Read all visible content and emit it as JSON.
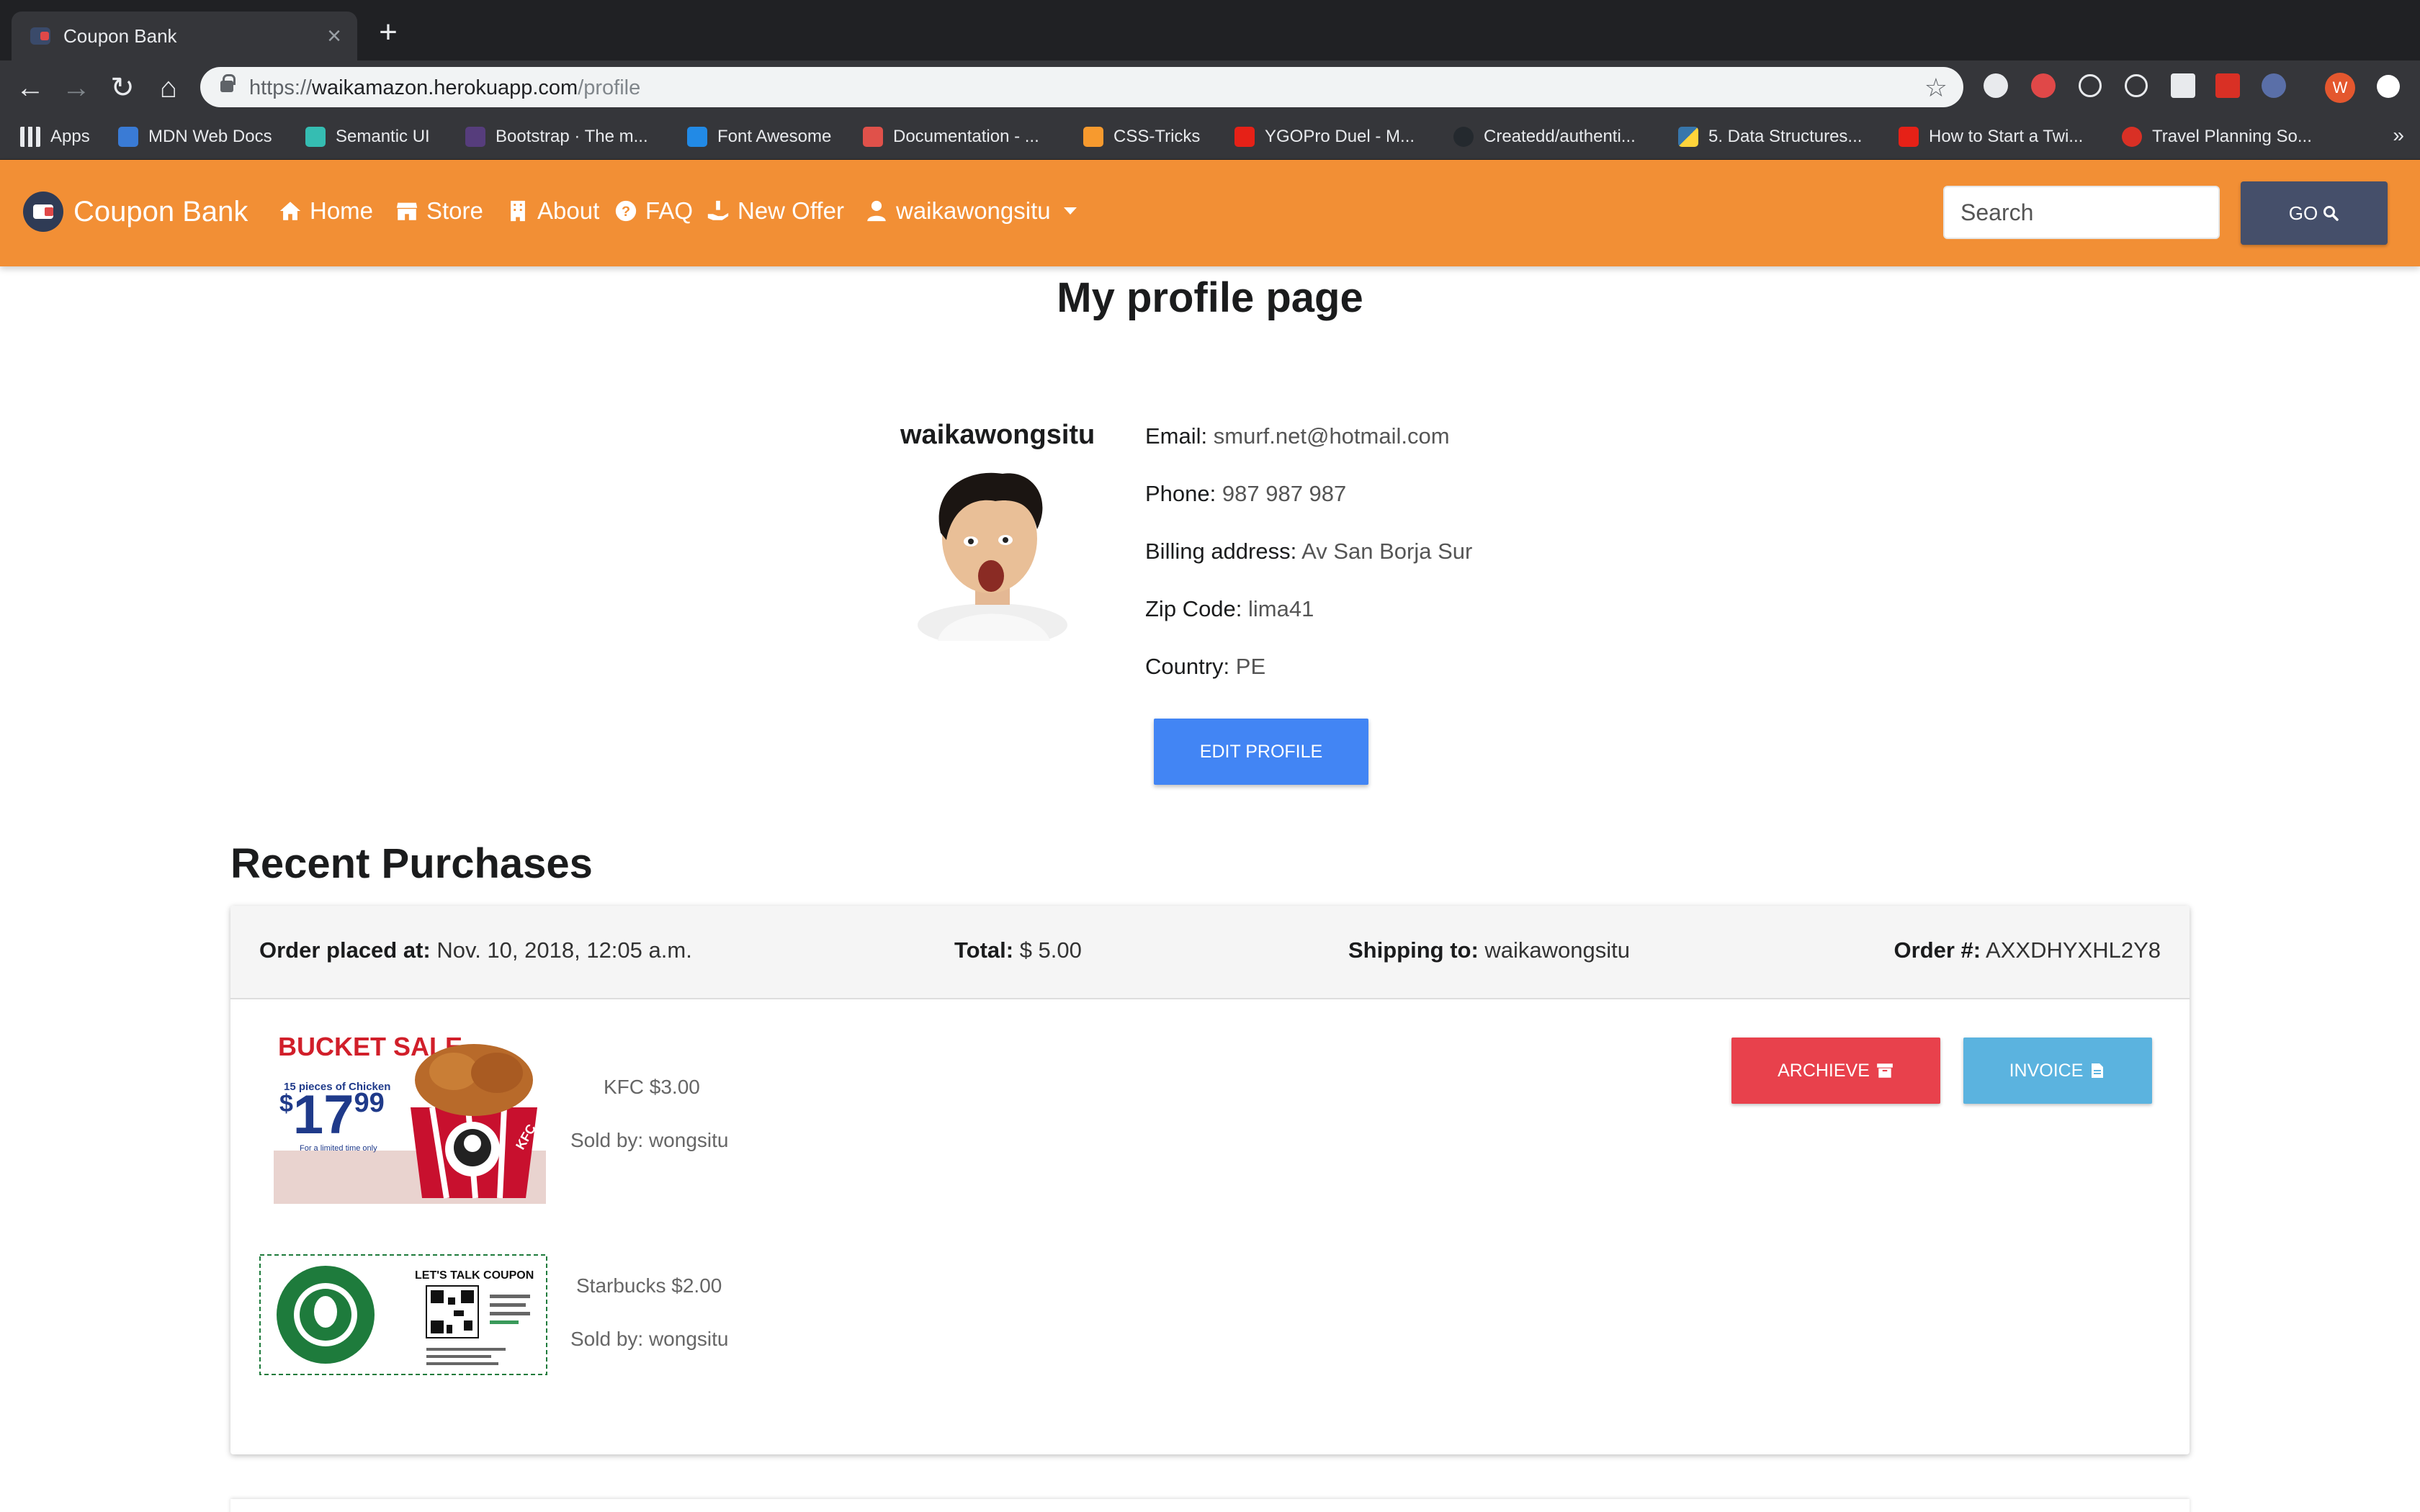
{
  "browser": {
    "tab_title": "Coupon Bank",
    "url_scheme": "https://",
    "url_host": "waikamazon.herokuapp.com",
    "url_path": "/profile",
    "avatar_letter": "W",
    "bookmarks": [
      {
        "label": "Apps",
        "icon": "apps-grid-icon",
        "color": "#e8eaed"
      },
      {
        "label": "MDN Web Docs",
        "icon": "mdn-icon",
        "color": "#3a7bd5"
      },
      {
        "label": "Semantic UI",
        "icon": "semantic-ui-icon",
        "color": "#35bdb2"
      },
      {
        "label": "Bootstrap · The m...",
        "icon": "bootstrap-icon",
        "color": "#563d7c"
      },
      {
        "label": "Font Awesome",
        "icon": "font-awesome-icon",
        "color": "#228ae6"
      },
      {
        "label": "Documentation - ...",
        "icon": "documentation-icon",
        "color": "#e0514a"
      },
      {
        "label": "CSS-Tricks",
        "icon": "css-tricks-icon",
        "color": "#f79a2e"
      },
      {
        "label": "YGOPro Duel - M...",
        "icon": "youtube-icon",
        "color": "#e62117"
      },
      {
        "label": "Createdd/authenti...",
        "icon": "github-icon",
        "color": "#24292e"
      },
      {
        "label": "5. Data Structures...",
        "icon": "python-icon",
        "color": "#3776ab"
      },
      {
        "label": "How to Start a Twi...",
        "icon": "youtube-icon",
        "color": "#e62117"
      },
      {
        "label": "Travel Planning So...",
        "icon": "travel-icon",
        "color": "#d93025"
      }
    ],
    "more_bookmarks": "»"
  },
  "site": {
    "brand": "Coupon Bank",
    "nav": {
      "home": "Home",
      "store": "Store",
      "about": "About",
      "faq": "FAQ",
      "new_offer": "New Offer",
      "user": "waikawongsitu"
    },
    "search_placeholder": "Search",
    "go_label": "GO",
    "colors": {
      "navbar": "#f28f35",
      "go_button": "#454f6a",
      "edit": "#4285f4",
      "archive": "#e8414c",
      "invoice": "#5bb3df"
    }
  },
  "profile": {
    "page_title": "My profile page",
    "username": "waikawongsitu",
    "fields": [
      {
        "label": "Email:",
        "value": "smurf.net@hotmail.com"
      },
      {
        "label": "Phone:",
        "value": "987 987 987"
      },
      {
        "label": "Billing address:",
        "value": "Av San Borja Sur"
      },
      {
        "label": "Zip Code:",
        "value": "lima41"
      },
      {
        "label": "Country:",
        "value": "PE"
      }
    ],
    "edit_button": "EDIT PROFILE"
  },
  "purchases": {
    "title": "Recent Purchases",
    "order": {
      "placed_label": "Order placed at:",
      "placed_value": "Nov. 10, 2018, 12:05 a.m.",
      "total_label": "Total:",
      "total_value": "$ 5.00",
      "shipping_label": "Shipping to:",
      "shipping_value": "waikawongsitu",
      "number_label": "Order #:",
      "number_value": "AXXDHYXHL2Y8",
      "archive_button": "ARCHIEVE",
      "invoice_button": "INVOICE",
      "items": [
        {
          "name": "KFC $3.00",
          "seller": "Sold by: wongsitu",
          "coupon_heading": "BUCKET SALE",
          "coupon_sub": "15 pieces of Chicken",
          "coupon_price_dollars": "17",
          "coupon_price_cents": "99",
          "coupon_note": "For a limited time only",
          "coupon_brand": "KFC"
        },
        {
          "name": "Starbucks $2.00",
          "seller": "Sold by: wongsitu",
          "coupon_heading": "LET'S TALK COUPON"
        }
      ]
    }
  }
}
